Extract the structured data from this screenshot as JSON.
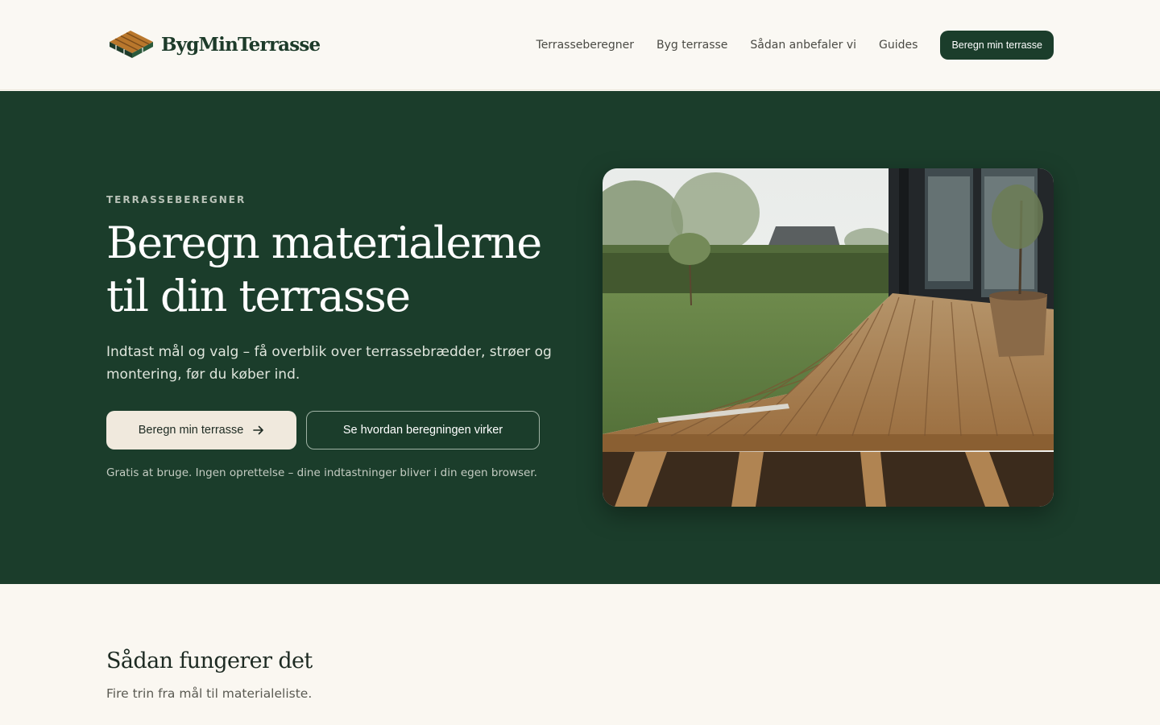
{
  "brand": {
    "name": "BygMinTerrasse"
  },
  "nav": {
    "links": [
      "Terrasseberegner",
      "Byg terrasse",
      "Sådan anbefaler vi",
      "Guides"
    ],
    "cta": "Beregn min terrasse"
  },
  "hero": {
    "eyebrow": "TERRASSEBEREGNER",
    "title": "Beregn materialerne til din terrasse",
    "subtitle": "Indtast mål og valg – få overblik over terrassebrædder, strøer og montering, før du køber ind.",
    "primary_button": "Beregn min terrasse",
    "secondary_button": "Se hvordan beregningen virker",
    "note": "Gratis at bruge. Ingen oprettelse – dine indtastninger bliver i din egen browser."
  },
  "section": {
    "title": "Sådan fungerer det",
    "subtitle": "Fire trin fra mål til materialeliste."
  },
  "icons": {
    "logo": "deck-boards-logo-icon",
    "primary_button_icon": "arrow-right-icon"
  },
  "colors": {
    "brand_green": "#1b3d2b",
    "cream": "#f0e9dd",
    "background": "#faf7f1"
  }
}
